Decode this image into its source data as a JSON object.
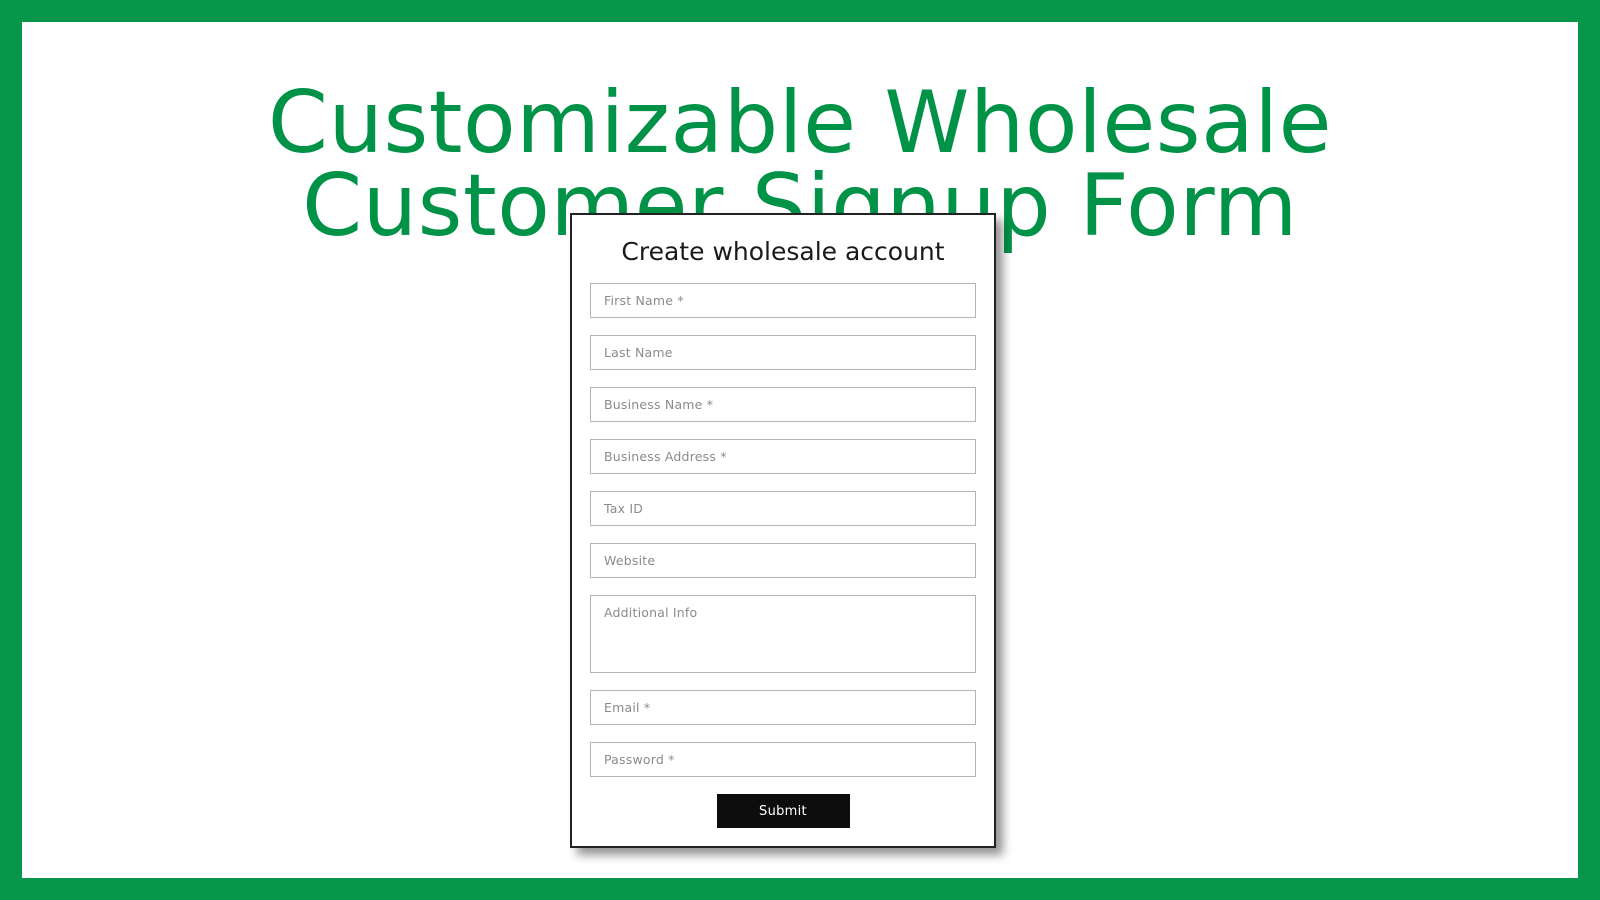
{
  "page": {
    "title": "Customizable Wholesale\nCustomer Signup Form",
    "frame_color": "#069649",
    "title_color": "#009246",
    "background_color": "#ffffff"
  },
  "card": {
    "heading": "Create wholesale account",
    "border_color": "#222222",
    "fields": [
      {
        "name": "first-name",
        "placeholder": "First Name *",
        "type": "text"
      },
      {
        "name": "last-name",
        "placeholder": "Last Name",
        "type": "text"
      },
      {
        "name": "business-name",
        "placeholder": "Business Name *",
        "type": "text"
      },
      {
        "name": "business-address",
        "placeholder": "Business Address *",
        "type": "text"
      },
      {
        "name": "tax-id",
        "placeholder": "Tax ID",
        "type": "text"
      },
      {
        "name": "website",
        "placeholder": "Website",
        "type": "text"
      },
      {
        "name": "additional-info",
        "placeholder": "Additional Info",
        "type": "textarea"
      },
      {
        "name": "email",
        "placeholder": "Email *",
        "type": "text"
      },
      {
        "name": "password",
        "placeholder": "Password *",
        "type": "password"
      }
    ],
    "submit": {
      "label": "Submit",
      "background_color": "#0d0d0d",
      "text_color": "#ffffff"
    }
  }
}
